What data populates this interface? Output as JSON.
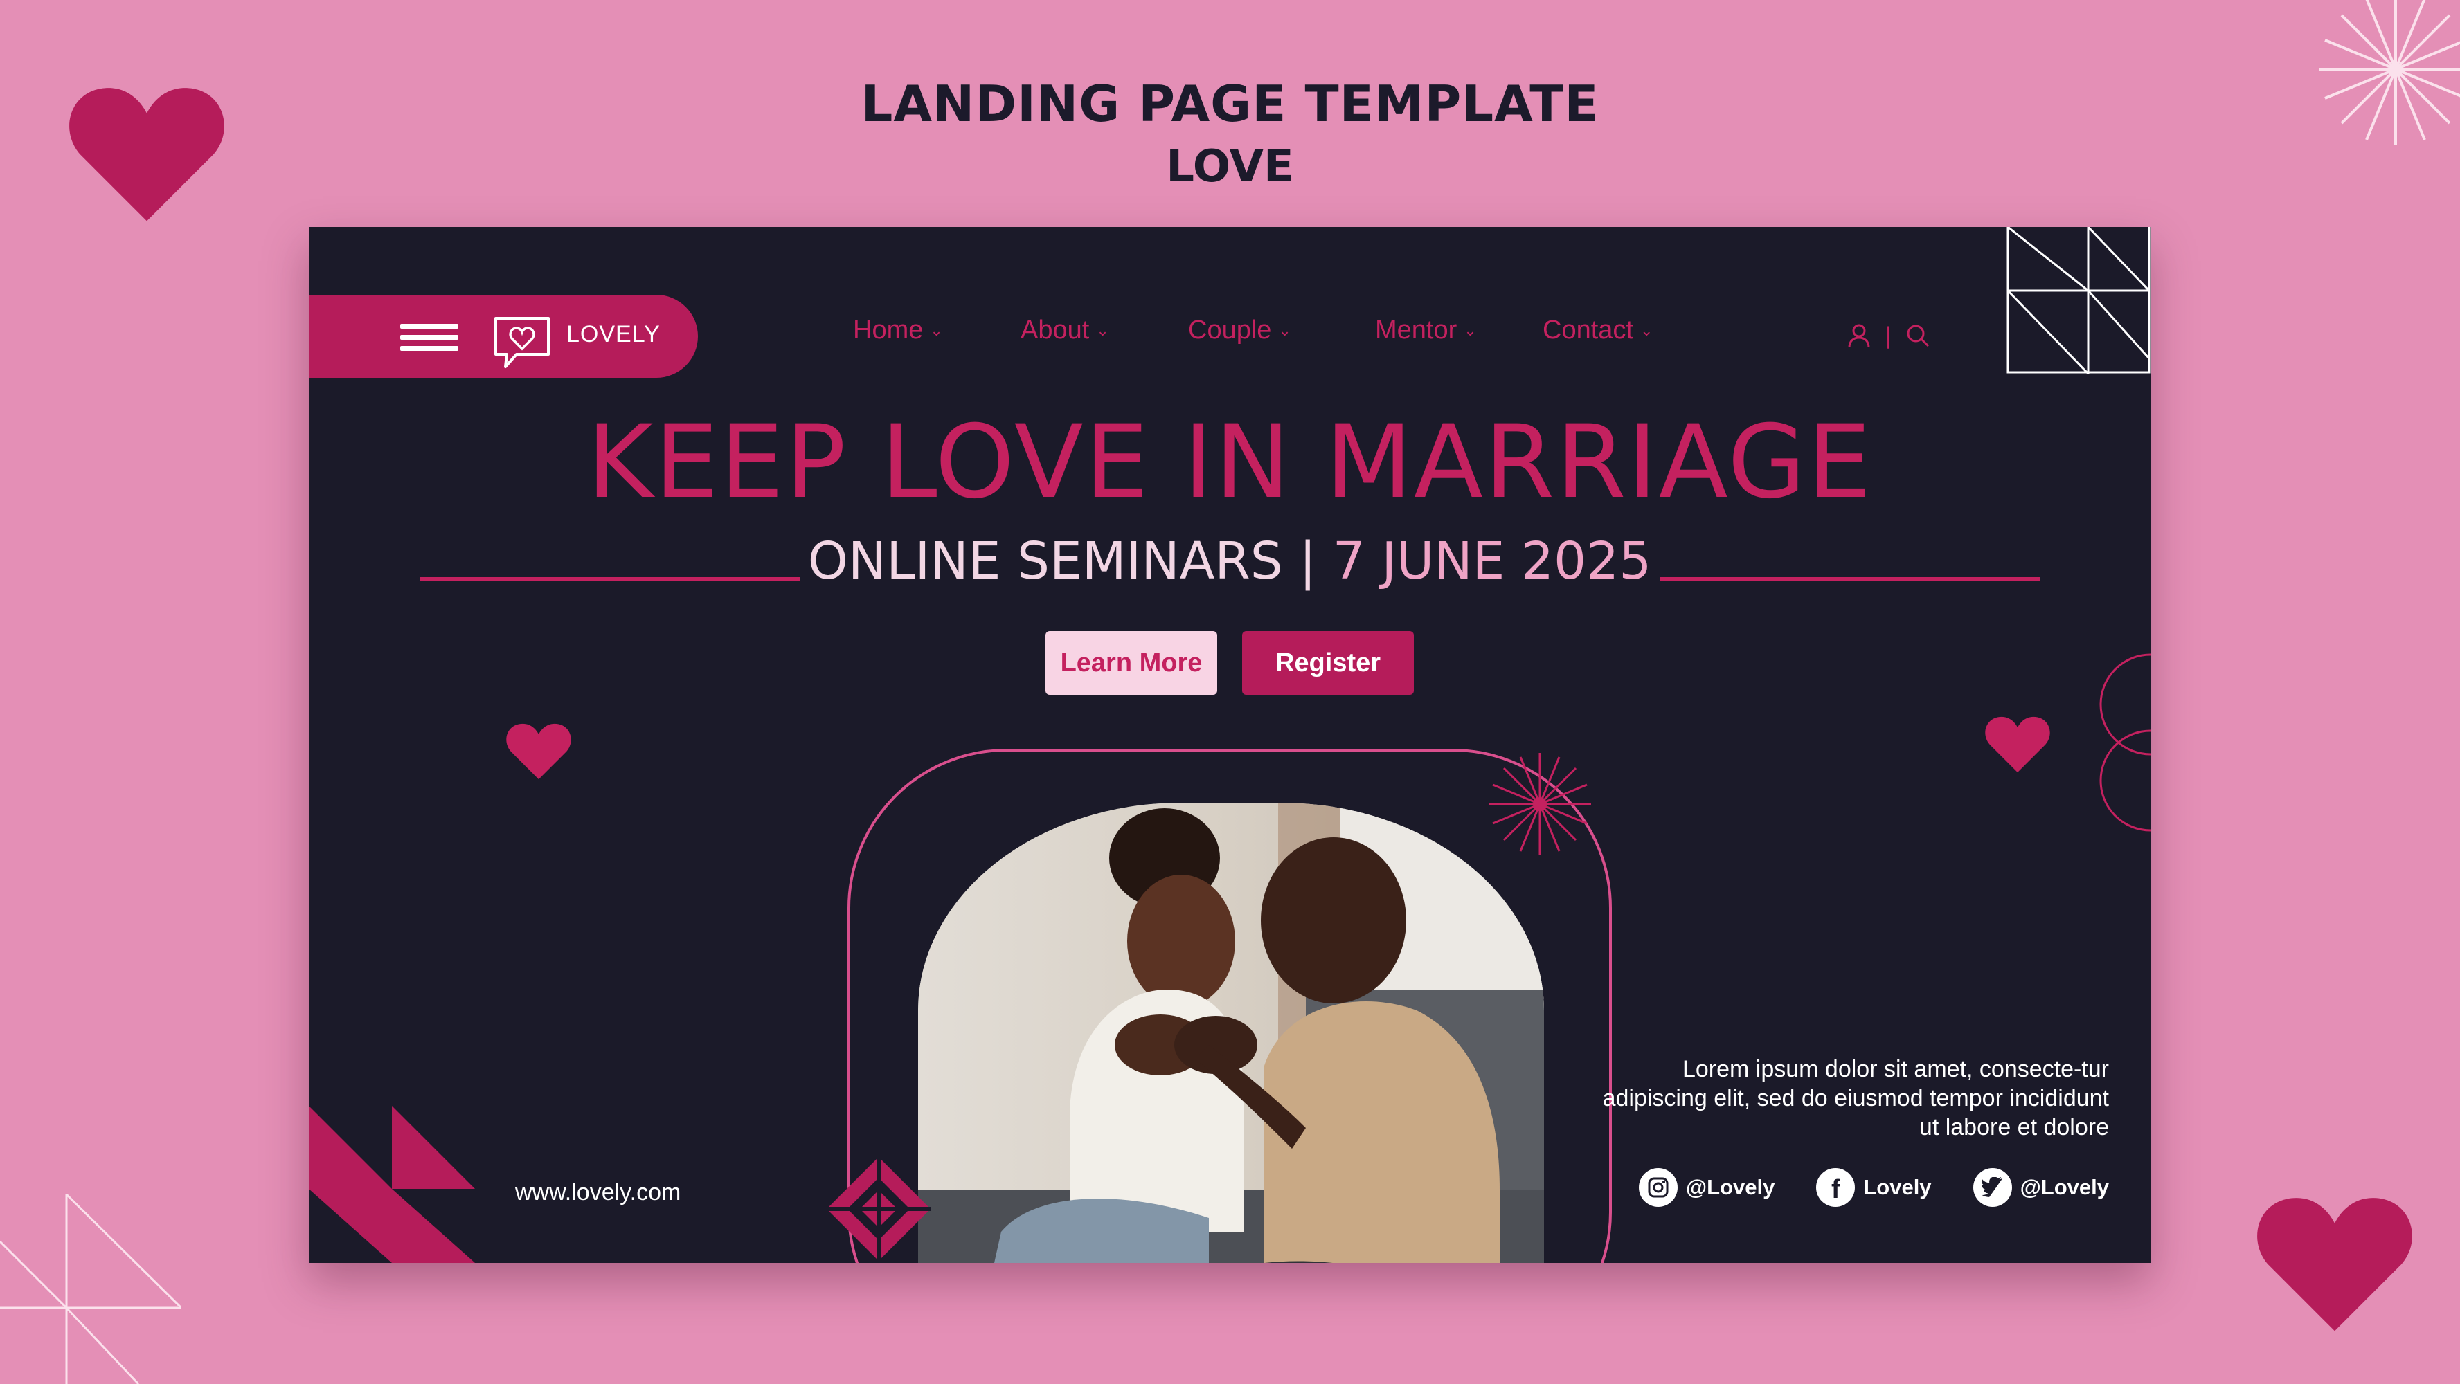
{
  "page": {
    "title_line1": "LANDING PAGE TEMPLATE",
    "title_line2": "LOVE"
  },
  "header": {
    "logo_text": "LOVELY",
    "menu": [
      {
        "label": "Home"
      },
      {
        "label": "About"
      },
      {
        "label": "Couple"
      },
      {
        "label": "Mentor"
      },
      {
        "label": "Contact"
      }
    ],
    "icons": [
      "menu-icon",
      "chat-heart-icon",
      "user-icon",
      "search-icon",
      "chevron-down-icon"
    ]
  },
  "hero": {
    "title": "KEEP LOVE IN MARRIAGE",
    "subtitle_event": "ONLINE SEMINARS",
    "subtitle_sep": " | ",
    "subtitle_date": "7 JUNE 2025",
    "learn_more": "Learn More",
    "register": "Register"
  },
  "footer": {
    "url": "www.lovely.com",
    "blurb": "Lorem ipsum dolor sit amet, consecte-tur adipiscing elit, sed do eiusmod tempor incididunt ut labore et dolore",
    "socials": [
      {
        "icon": "instagram-icon",
        "label": "@Lovely"
      },
      {
        "icon": "facebook-icon",
        "label": "Lovely"
      },
      {
        "icon": "twitter-icon",
        "label": "@Lovely"
      }
    ]
  },
  "colors": {
    "page_bg": "#e48fb6",
    "panel_bg": "#1b1a29",
    "accent": "#b51c5a",
    "accent_text": "#c4215f",
    "light_pink": "#f8d4e4"
  }
}
